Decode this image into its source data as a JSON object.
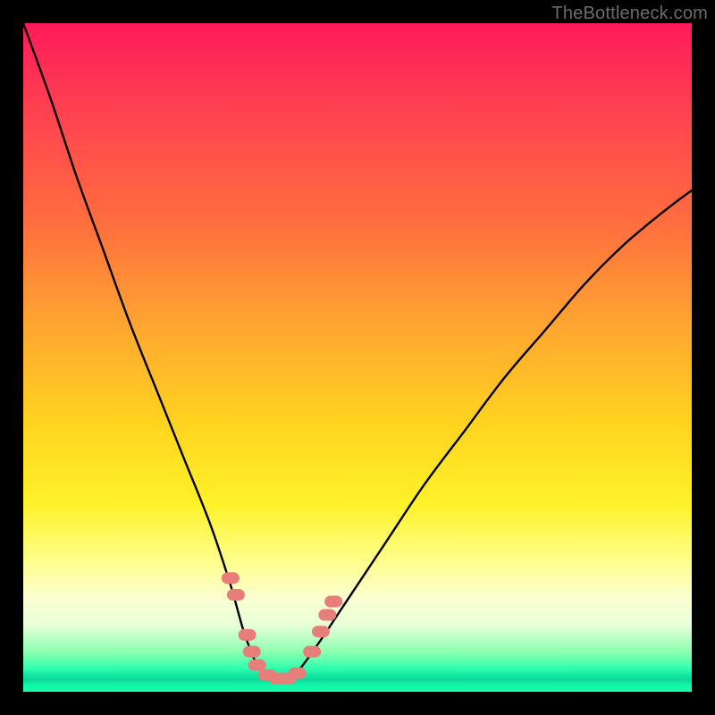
{
  "watermark": {
    "text": "TheBottleneck.com"
  },
  "chart_data": {
    "type": "line",
    "title": "",
    "xlabel": "",
    "ylabel": "",
    "xlim": [
      0,
      100
    ],
    "ylim": [
      0,
      100
    ],
    "grid": false,
    "legend": false,
    "note": "V-shaped bottleneck curve; y≈100 at extremes, dips to ~2 near x≈34–41. Values estimated from pixels.",
    "series": [
      {
        "name": "bottleneck-curve",
        "x": [
          0,
          4,
          8,
          12,
          16,
          20,
          24,
          28,
          31,
          33,
          35,
          37,
          39,
          41,
          44,
          48,
          54,
          60,
          66,
          72,
          78,
          84,
          90,
          96,
          100
        ],
        "values": [
          100,
          89,
          77,
          66,
          55,
          45,
          35,
          25,
          16,
          9,
          4,
          2,
          2,
          3,
          7,
          13,
          22,
          31,
          39,
          47,
          54,
          61,
          67,
          72,
          75
        ]
      }
    ],
    "markers": {
      "name": "highlighted-points",
      "note": "Salmon caplet markers near the valley.",
      "points": [
        {
          "x": 31.0,
          "y": 17.0
        },
        {
          "x": 31.8,
          "y": 14.5
        },
        {
          "x": 33.5,
          "y": 8.5
        },
        {
          "x": 34.2,
          "y": 6.0
        },
        {
          "x": 35.0,
          "y": 4.0
        },
        {
          "x": 36.5,
          "y": 2.5
        },
        {
          "x": 38.0,
          "y": 2.0
        },
        {
          "x": 39.5,
          "y": 2.0
        },
        {
          "x": 41.0,
          "y": 2.8
        },
        {
          "x": 43.2,
          "y": 6.0
        },
        {
          "x": 44.5,
          "y": 9.0
        },
        {
          "x": 45.5,
          "y": 11.5
        },
        {
          "x": 46.4,
          "y": 13.5
        }
      ]
    },
    "background_gradient": {
      "top": "#ff1a58",
      "mid": "#ffd41f",
      "bottom": "#14ffad"
    }
  }
}
